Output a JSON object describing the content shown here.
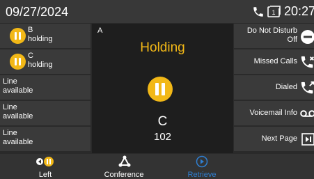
{
  "status_bar": {
    "date": "09/27/2024",
    "time": "20:27",
    "icons": [
      "phone-icon",
      "voicemail-count-icon"
    ]
  },
  "lines": [
    {
      "name": "B",
      "status": "holding",
      "icon": "hold-icon"
    },
    {
      "name": "C",
      "status": "holding",
      "icon": "hold-icon"
    },
    {
      "name": "Line",
      "status": "available"
    },
    {
      "name": "Line",
      "status": "available"
    },
    {
      "name": "Line",
      "status": "available"
    }
  ],
  "center": {
    "line_label": "A",
    "state": "Holding",
    "name": "C",
    "number": "102"
  },
  "features": [
    {
      "label_line1": "Do Not Disturb",
      "label_line2": "Off",
      "icon": "dnd-icon"
    },
    {
      "label_line1": "Missed Calls",
      "icon": "missed-calls-icon"
    },
    {
      "label_line1": "Dialed",
      "icon": "dialed-icon"
    },
    {
      "label_line1": "Voicemail Info",
      "icon": "voicemail-icon"
    },
    {
      "label_line1": "Next Page",
      "icon": "next-page-icon"
    }
  ],
  "softkeys": [
    {
      "label": "Left",
      "icon": "left-hold-icon"
    },
    {
      "label": "Conference",
      "icon": "conference-icon"
    },
    {
      "label": "Retrieve",
      "icon": "retrieve-icon",
      "active": true
    }
  ],
  "colors": {
    "accent_hold": "#f2b817",
    "active_softkey": "#2f7fd1",
    "background": "#2a2a2a"
  }
}
